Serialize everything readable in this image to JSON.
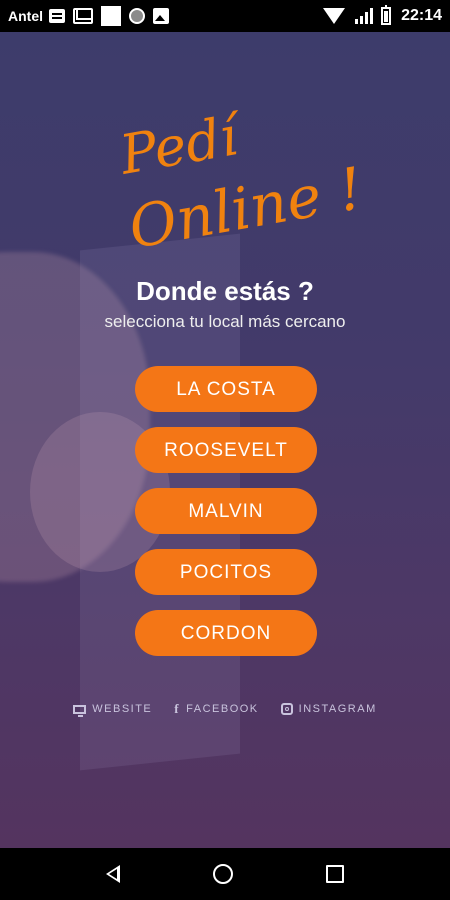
{
  "status_bar": {
    "carrier": "Antel",
    "time": "22:14",
    "notification_icons": [
      "message-icon",
      "gmail-icon",
      "square-icon",
      "circle-icon",
      "image-icon"
    ],
    "system_icons": [
      "wifi-icon",
      "signal-icon",
      "battery-icon"
    ]
  },
  "logo": {
    "line1": "Pedí",
    "line2": "Online !",
    "color": "#f0820f"
  },
  "header": {
    "title": "Donde estás ?",
    "subtitle": "selecciona tu local más cercano"
  },
  "locations": [
    {
      "label": "LA COSTA"
    },
    {
      "label": "ROOSEVELT"
    },
    {
      "label": "MALVIN"
    },
    {
      "label": "POCITOS"
    },
    {
      "label": "CORDON"
    }
  ],
  "social_links": [
    {
      "label": "WEBSITE",
      "icon": "monitor-icon"
    },
    {
      "label": "FACEBOOK",
      "icon": "facebook-icon"
    },
    {
      "label": "INSTAGRAM",
      "icon": "instagram-icon"
    }
  ],
  "nav_bar": {
    "buttons": [
      "back-icon",
      "home-icon",
      "recents-icon"
    ]
  },
  "colors": {
    "accent": "#f47616",
    "background_top": "#3d3c6b",
    "background_bottom": "#54345f"
  }
}
